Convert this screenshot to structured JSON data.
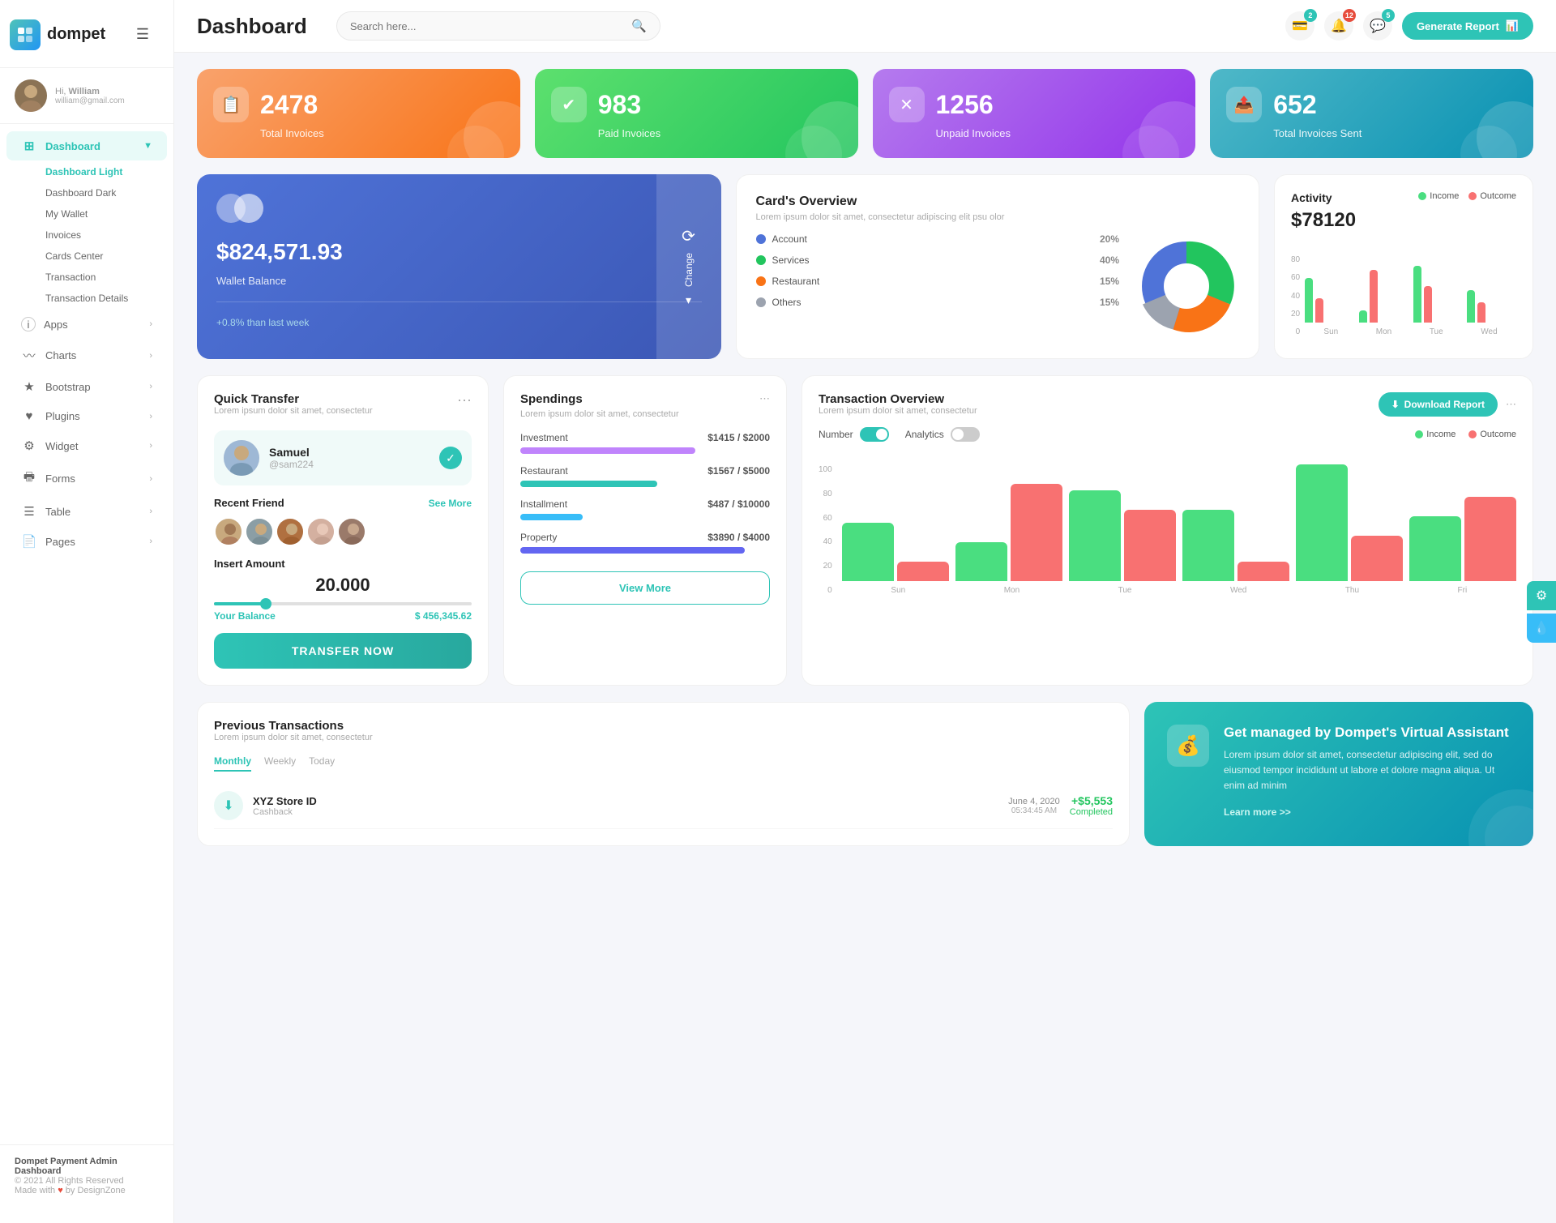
{
  "app": {
    "name": "dompet",
    "title": "Dashboard"
  },
  "header": {
    "search_placeholder": "Search here...",
    "generate_btn": "Generate Report",
    "badges": {
      "wallet": "2",
      "bell": "12",
      "chat": "5"
    }
  },
  "sidebar": {
    "user": {
      "hi": "Hi,",
      "name": "William",
      "email": "william@gmail.com"
    },
    "menu": [
      {
        "id": "dashboard",
        "label": "Dashboard",
        "icon": "⊞",
        "active": true,
        "has_arrow": true
      },
      {
        "id": "apps",
        "label": "Apps",
        "icon": "ℹ",
        "active": false,
        "has_arrow": true
      },
      {
        "id": "charts",
        "label": "Charts",
        "icon": "📈",
        "active": false,
        "has_arrow": true
      },
      {
        "id": "bootstrap",
        "label": "Bootstrap",
        "icon": "★",
        "active": false,
        "has_arrow": true
      },
      {
        "id": "plugins",
        "label": "Plugins",
        "icon": "♥",
        "active": false,
        "has_arrow": true
      },
      {
        "id": "widget",
        "label": "Widget",
        "icon": "⚙",
        "active": false,
        "has_arrow": true
      },
      {
        "id": "forms",
        "label": "Forms",
        "icon": "📋",
        "active": false,
        "has_arrow": true
      },
      {
        "id": "table",
        "label": "Table",
        "icon": "☰",
        "active": false,
        "has_arrow": true
      },
      {
        "id": "pages",
        "label": "Pages",
        "icon": "📄",
        "active": false,
        "has_arrow": true
      }
    ],
    "submenu": [
      {
        "id": "dashboard-light",
        "label": "Dashboard Light",
        "active": true
      },
      {
        "id": "dashboard-dark",
        "label": "Dashboard Dark",
        "active": false
      },
      {
        "id": "my-wallet",
        "label": "My Wallet",
        "active": false
      },
      {
        "id": "invoices",
        "label": "Invoices",
        "active": false
      },
      {
        "id": "cards-center",
        "label": "Cards Center",
        "active": false
      },
      {
        "id": "transaction",
        "label": "Transaction",
        "active": false
      },
      {
        "id": "transaction-details",
        "label": "Transaction Details",
        "active": false
      }
    ],
    "footer": {
      "brand": "Dompet Payment Admin Dashboard",
      "copyright": "© 2021 All Rights Reserved",
      "made_with": "Made with",
      "by": "by DesignZone"
    }
  },
  "stats": [
    {
      "id": "total-invoices",
      "number": "2478",
      "label": "Total Invoices",
      "color": "orange",
      "icon": "📋"
    },
    {
      "id": "paid-invoices",
      "number": "983",
      "label": "Paid Invoices",
      "color": "green",
      "icon": "✅"
    },
    {
      "id": "unpaid-invoices",
      "number": "1256",
      "label": "Unpaid Invoices",
      "color": "purple",
      "icon": "❌"
    },
    {
      "id": "total-sent",
      "number": "652",
      "label": "Total Invoices Sent",
      "color": "teal",
      "icon": "📤"
    }
  ],
  "wallet": {
    "balance": "$824,571.93",
    "label": "Wallet Balance",
    "change": "+0.8% than last week",
    "change_btn": "Change"
  },
  "card_overview": {
    "title": "Card's Overview",
    "desc": "Lorem ipsum dolor sit amet, consectetur adipiscing elit psu olor",
    "legend": [
      {
        "name": "Account",
        "pct": "20%",
        "color": "#4f73d8"
      },
      {
        "name": "Services",
        "pct": "40%",
        "color": "#22c55e"
      },
      {
        "name": "Restaurant",
        "pct": "15%",
        "color": "#f97316"
      },
      {
        "name": "Others",
        "pct": "15%",
        "color": "#9ca3af"
      }
    ],
    "chart": {
      "segments": [
        {
          "color": "#4f73d8",
          "pct": 20
        },
        {
          "color": "#22c55e",
          "pct": 40
        },
        {
          "color": "#f97316",
          "pct": 15
        },
        {
          "color": "#9ca3af",
          "pct": 15
        },
        {
          "color": "#fff",
          "pct": 10
        }
      ]
    }
  },
  "activity": {
    "title": "Activity",
    "amount": "$78120",
    "income_label": "Income",
    "outcome_label": "Outcome",
    "bars": [
      {
        "day": "Sun",
        "income": 55,
        "outcome": 30
      },
      {
        "day": "Mon",
        "income": 15,
        "outcome": 65
      },
      {
        "day": "Tue",
        "income": 70,
        "outcome": 45
      },
      {
        "day": "Wed",
        "income": 40,
        "outcome": 25
      }
    ],
    "y_labels": [
      "80",
      "60",
      "40",
      "20",
      "0"
    ]
  },
  "quick_transfer": {
    "title": "Quick Transfer",
    "desc": "Lorem ipsum dolor sit amet, consectetur",
    "person": {
      "name": "Samuel",
      "handle": "@sam224"
    },
    "recent_label": "Recent Friend",
    "see_all": "See More",
    "insert_label": "Insert Amount",
    "amount": "20.000",
    "balance_label": "Your Balance",
    "balance_value": "$ 456,345.62",
    "transfer_btn": "TRANSFER NOW"
  },
  "spendings": {
    "title": "Spendings",
    "desc": "Lorem ipsum dolor sit amet, consectetur",
    "items": [
      {
        "name": "Investment",
        "amount": "$1415",
        "total": "$2000",
        "pct": 70,
        "color": "#c084fc"
      },
      {
        "name": "Restaurant",
        "amount": "$1567",
        "total": "$5000",
        "pct": 55,
        "color": "#2ec4b6"
      },
      {
        "name": "Installment",
        "amount": "$487",
        "total": "$10000",
        "pct": 25,
        "color": "#38bdf8"
      },
      {
        "name": "Property",
        "amount": "$3890",
        "total": "$4000",
        "pct": 90,
        "color": "#6366f1"
      }
    ],
    "view_more_btn": "View More"
  },
  "transaction_overview": {
    "title": "Transaction Overview",
    "desc": "Lorem ipsum dolor sit amet, consectetur",
    "number_label": "Number",
    "analytics_label": "Analytics",
    "income_label": "Income",
    "outcome_label": "Outcome",
    "download_btn": "Download Report",
    "bars": [
      {
        "day": "Sun",
        "income": 45,
        "outcome": 15
      },
      {
        "day": "Mon",
        "income": 30,
        "outcome": 75
      },
      {
        "day": "Tue",
        "income": 70,
        "outcome": 55
      },
      {
        "day": "Wed",
        "income": 55,
        "outcome": 15
      },
      {
        "day": "Thu",
        "income": 90,
        "outcome": 35
      },
      {
        "day": "Fri",
        "income": 50,
        "outcome": 65
      }
    ],
    "y_labels": [
      "100",
      "80",
      "60",
      "40",
      "20",
      "0"
    ]
  },
  "prev_transactions": {
    "title": "Previous Transactions",
    "desc": "Lorem ipsum dolor sit amet, consectetur",
    "tabs": [
      "Monthly",
      "Weekly",
      "Today"
    ],
    "active_tab": "Monthly",
    "items": [
      {
        "icon": "⬇",
        "name": "XYZ Store ID",
        "sub": "Cashback",
        "date": "June 4, 2020",
        "time": "05:34:45 AM",
        "amount": "+$5,553",
        "status": "Completed"
      }
    ]
  },
  "virtual_assistant": {
    "title": "Get managed by Dompet's Virtual Assistant",
    "desc": "Lorem ipsum dolor sit amet, consectetur adipiscing elit, sed do eiusmod tempor incididunt ut labore et dolore magna aliqua. Ut enim ad minim",
    "link": "Learn more >>"
  }
}
